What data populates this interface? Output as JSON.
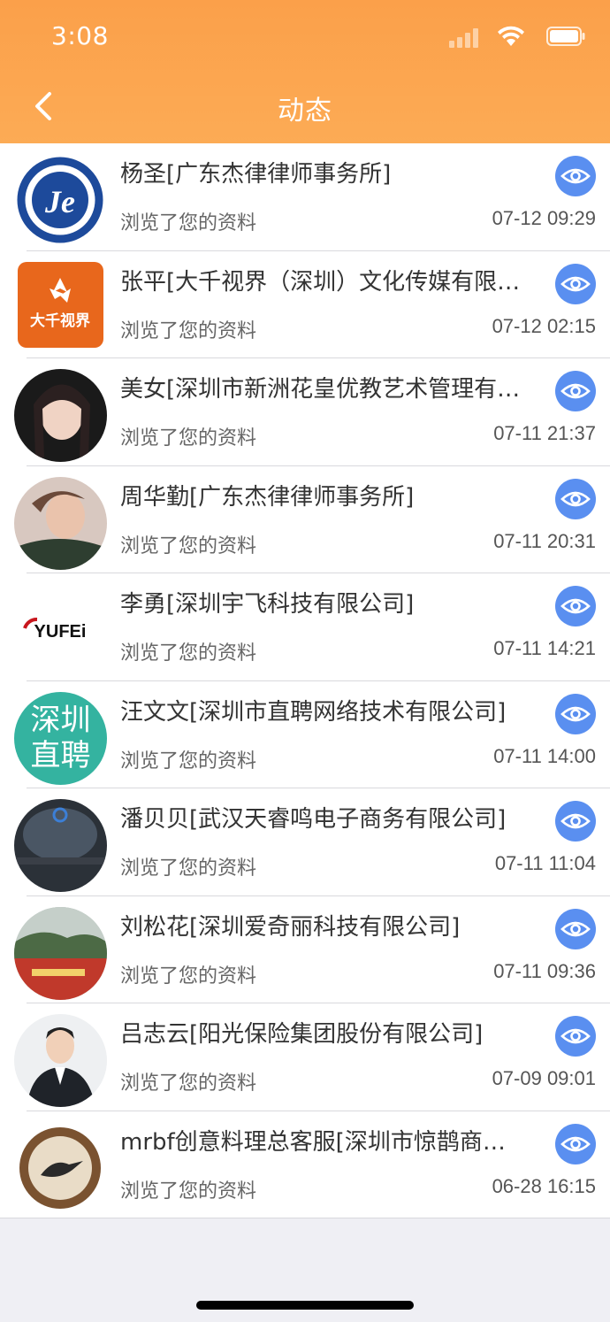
{
  "status_bar": {
    "time": "3:08"
  },
  "header": {
    "title": "动态"
  },
  "colors": {
    "header": "#fca24e",
    "accent": "#5a8ff0"
  },
  "items": [
    {
      "name": "杨圣[广东杰律律师事务所]",
      "action": "浏览了您的资料",
      "time": "07-12 09:29"
    },
    {
      "name": "张平[大千视界（深圳）文化传媒有限…",
      "action": "浏览了您的资料",
      "time": "07-12 02:15",
      "avatar_text": "大千视界"
    },
    {
      "name": "美女[深圳市新洲花皇优教艺术管理有…",
      "action": "浏览了您的资料",
      "time": "07-11 21:37"
    },
    {
      "name": "周华勤[广东杰律律师事务所]",
      "action": "浏览了您的资料",
      "time": "07-11 20:31"
    },
    {
      "name": "李勇[深圳宇飞科技有限公司]",
      "action": "浏览了您的资料",
      "time": "07-11 14:21",
      "avatar_text": "YUFEi"
    },
    {
      "name": "汪文文[深圳市直聘网络技术有限公司]",
      "action": "浏览了您的资料",
      "time": "07-11 14:00",
      "avatar_text": "深圳直聘"
    },
    {
      "name": "潘贝贝[武汉天睿鸣电子商务有限公司]",
      "action": "浏览了您的资料",
      "time": "07-11 11:04"
    },
    {
      "name": "刘松花[深圳爱奇丽科技有限公司]",
      "action": "浏览了您的资料",
      "time": "07-11 09:36"
    },
    {
      "name": "吕志云[阳光保险集团股份有限公司]",
      "action": "浏览了您的资料",
      "time": "07-09 09:01"
    },
    {
      "name": "mrbf创意料理总客服[深圳市惊鹊商…",
      "action": "浏览了您的资料",
      "time": "06-28 16:15"
    }
  ]
}
